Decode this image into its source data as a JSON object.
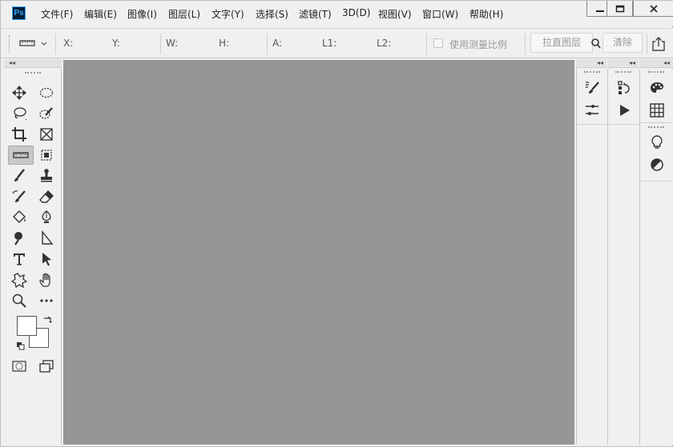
{
  "app": {
    "logo_text": "Ps"
  },
  "menu": [
    {
      "label": "文件(F)",
      "name": "menu-file"
    },
    {
      "label": "编辑(E)",
      "name": "menu-edit"
    },
    {
      "label": "图像(I)",
      "name": "menu-image"
    },
    {
      "label": "图层(L)",
      "name": "menu-layer"
    },
    {
      "label": "文字(Y)",
      "name": "menu-type"
    },
    {
      "label": "选择(S)",
      "name": "menu-select"
    },
    {
      "label": "滤镜(T)",
      "name": "menu-filter"
    },
    {
      "label": "3D(D)",
      "name": "menu-3d"
    },
    {
      "label": "视图(V)",
      "name": "menu-view"
    },
    {
      "label": "窗口(W)",
      "name": "menu-window"
    },
    {
      "label": "帮助(H)",
      "name": "menu-help"
    }
  ],
  "window_controls": {
    "minimize": "—",
    "maximize": "☐",
    "close": "✕"
  },
  "options": {
    "x_label": "X:",
    "y_label": "Y:",
    "w_label": "W:",
    "h_label": "H:",
    "a_label": "A:",
    "l1_label": "L1:",
    "l2_label": "L2:",
    "scale_checkbox_label": "使用测量比例",
    "straighten_button": "拉直图层",
    "clear_button": "清除"
  },
  "panel_collapse_glyph": "◂◂",
  "tools": [
    "move-tool-icon",
    "marquee-tool-icon",
    "lasso-tool-icon",
    "quick-selection-tool-icon",
    "crop-tool-icon",
    "frame-tool-icon",
    "ruler-tool-icon",
    "object-selection-tool-icon",
    "brush-tool-icon",
    "clone-stamp-tool-icon",
    "history-brush-tool-icon",
    "eraser-tool-icon",
    "paint-bucket-tool-icon",
    "pen-tool-icon",
    "dodge-tool-icon",
    "path-selection-tool-icon",
    "type-tool-icon",
    "direct-selection-tool-icon",
    "custom-shape-tool-icon",
    "hand-tool-icon",
    "zoom-tool-icon",
    "more-tools-icon"
  ],
  "colors": {
    "canvas_bg": "#969696",
    "ui_bg": "#f0f0f0",
    "foreground_swatch": "#ffffff",
    "background_swatch": "#ffffff"
  }
}
